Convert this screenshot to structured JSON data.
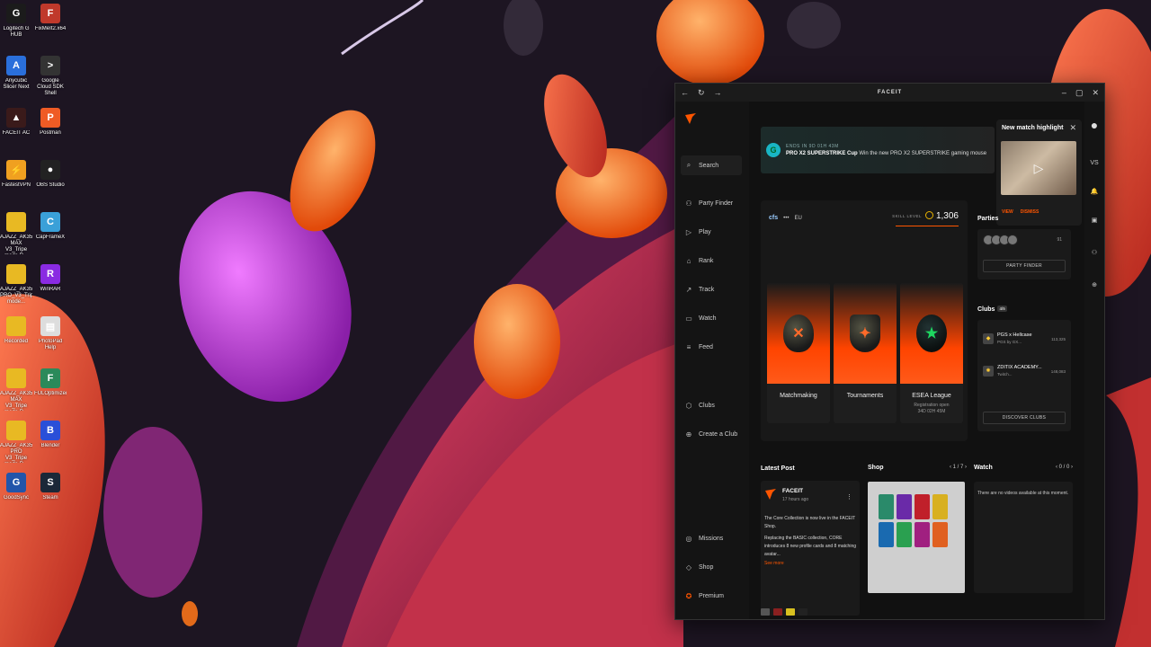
{
  "desktop": {
    "icons": [
      {
        "label": "Logitech G HUB",
        "icon": "logitech-g-hub-icon",
        "glyph": "G",
        "color": "#1b1b1b"
      },
      {
        "label": "FixMeIt2.x64",
        "icon": "fixmeit-icon",
        "glyph": "F",
        "color": "#c0392b"
      },
      {
        "label": "Anycubic Slicer Next",
        "icon": "anycubic-slicer-icon",
        "glyph": "A",
        "color": "#2a6fdb"
      },
      {
        "label": "Google Cloud SDK Shell",
        "icon": "cloud-sdk-shell-icon",
        "glyph": ">",
        "color": "#333333"
      },
      {
        "label": "FACEIT AC",
        "icon": "faceit-ac-icon",
        "glyph": "▲",
        "color": "#3a1a1a"
      },
      {
        "label": "Postman",
        "icon": "postman-icon",
        "glyph": "P",
        "color": "#ef5b25"
      },
      {
        "label": "FastestVPN",
        "icon": "fastestvpn-icon",
        "glyph": "⚡",
        "color": "#f0a020"
      },
      {
        "label": "OBS Studio",
        "icon": "obs-studio-icon",
        "glyph": "●",
        "color": "#222222"
      },
      {
        "label": "AJAZZ_AK35I MAX V3_Tripe mode R...",
        "icon": "folder-icon",
        "glyph": "",
        "color": "#e8b923"
      },
      {
        "label": "CapFrameX",
        "icon": "capframex-icon",
        "glyph": "C",
        "color": "#3aa0d8"
      },
      {
        "label": "AJAZZ_AK35I PRO_V3_Tripe mode...",
        "icon": "folder-icon",
        "glyph": "",
        "color": "#e8b923"
      },
      {
        "label": "WinRAR",
        "icon": "winrar-icon",
        "glyph": "R",
        "color": "#8a2be2"
      },
      {
        "label": "Recorded",
        "icon": "folder-icon",
        "glyph": "",
        "color": "#e8b923"
      },
      {
        "label": "PhotoPad Help",
        "icon": "pdf-icon",
        "glyph": "▤",
        "color": "#dddddd"
      },
      {
        "label": "AJAZZ_AK35I MAX V3_Tripe mode R...",
        "icon": "folder-icon",
        "glyph": "",
        "color": "#e8b923"
      },
      {
        "label": "FULOptimizer",
        "icon": "optimizer-icon",
        "glyph": "F",
        "color": "#2b8a5a"
      },
      {
        "label": "AJAZZ_AK35I PRO V3_Tripe mode R...",
        "icon": "folder-icon",
        "glyph": "",
        "color": "#e8b923"
      },
      {
        "label": "Blender",
        "icon": "blender-icon",
        "glyph": "B",
        "color": "#2a4fd8"
      },
      {
        "label": "GoodSync",
        "icon": "goodsync-icon",
        "glyph": "G",
        "color": "#2255aa"
      },
      {
        "label": "Steam",
        "icon": "steam-icon",
        "glyph": "S",
        "color": "#1b2838"
      }
    ]
  },
  "window": {
    "title": "FACEIT",
    "sidebar": [
      {
        "label": "Search",
        "icon": "search-icon",
        "glyph": "⌕"
      },
      {
        "label": "Party Finder",
        "icon": "party-finder-icon",
        "glyph": "⚇"
      },
      {
        "label": "Play",
        "icon": "play-icon",
        "glyph": "▷"
      },
      {
        "label": "Rank",
        "icon": "rank-icon",
        "glyph": "⌂"
      },
      {
        "label": "Track",
        "icon": "track-icon",
        "glyph": "↗"
      },
      {
        "label": "Watch",
        "icon": "watch-icon",
        "glyph": "▭"
      },
      {
        "label": "Feed",
        "icon": "feed-icon",
        "glyph": "≡"
      },
      {
        "label": "Clubs",
        "icon": "clubs-icon",
        "glyph": "⬡"
      },
      {
        "label": "Create a Club",
        "icon": "create-club-icon",
        "glyph": "⊕"
      },
      {
        "label": "Missions",
        "icon": "missions-icon",
        "glyph": "◎"
      },
      {
        "label": "Shop",
        "icon": "shop-icon",
        "glyph": "◇"
      },
      {
        "label": "Premium",
        "icon": "premium-icon",
        "glyph": "✪"
      }
    ],
    "rightrail": [
      {
        "label": "",
        "icon": "avatar-icon",
        "glyph": "●"
      },
      {
        "label": "VS",
        "icon": "versus-icon",
        "glyph": "VS"
      },
      {
        "label": "",
        "icon": "notification-bell-icon",
        "glyph": "🔔"
      },
      {
        "label": "",
        "icon": "chat-icon",
        "glyph": "▣"
      },
      {
        "label": "",
        "icon": "friends-icon",
        "glyph": "⚇"
      },
      {
        "label": "",
        "icon": "add-icon",
        "glyph": "⊕"
      }
    ],
    "banner": {
      "ends": "ENDS IN 9D 01H 43M",
      "title": "PRO X2 SUPERSTRIKE Cup",
      "text": "Win the new PRO X2 SUPERSTRIKE gaming mouse"
    },
    "highlight": {
      "title": "New match highlight",
      "view": "VIEW",
      "dismiss": "DISMISS"
    },
    "match": {
      "game": "cfs",
      "region": "EU",
      "skill_label": "SKILL LEVEL",
      "elo": "1,306",
      "modes": [
        {
          "name": "Matchmaking",
          "sub": "",
          "glyph": "✕",
          "kind": "orb"
        },
        {
          "name": "Tournaments",
          "sub": "",
          "glyph": "✦",
          "kind": "cup"
        },
        {
          "name": "ESEA League",
          "sub": "Registration open\n34D 02H 45M",
          "glyph": "★",
          "kind": "star"
        }
      ]
    },
    "parties": {
      "title": "Parties",
      "count": "91",
      "button": "PARTY FINDER"
    },
    "clubs": {
      "title": "Clubs",
      "badge": "4/5",
      "items": [
        {
          "name": "PGS x Hellcase",
          "sub": "PGS by GX...",
          "members": "113,325"
        },
        {
          "name": "ZDITIX ACADEMY...",
          "sub": "Twitch...",
          "members": "148,083"
        }
      ],
      "button": "DISCOVER CLUBS"
    },
    "latest": {
      "title": "Latest Post",
      "author": "FACEIT",
      "time": "17 hours ago",
      "body1": "The Core Collection is now live in the FACEIT Shop.",
      "body2": "Replacing the BASIC collection, CORE introduces 8 new profile cards and 8 matching avatar...",
      "more": "See more"
    },
    "shop": {
      "title": "Shop",
      "pager": "1 / 7"
    },
    "watch": {
      "title": "Watch",
      "pager": "0 / 0",
      "empty": "There are no videos available at this moment."
    }
  },
  "colors": {
    "accent": "#ff5500",
    "window_bg": "#111111"
  }
}
